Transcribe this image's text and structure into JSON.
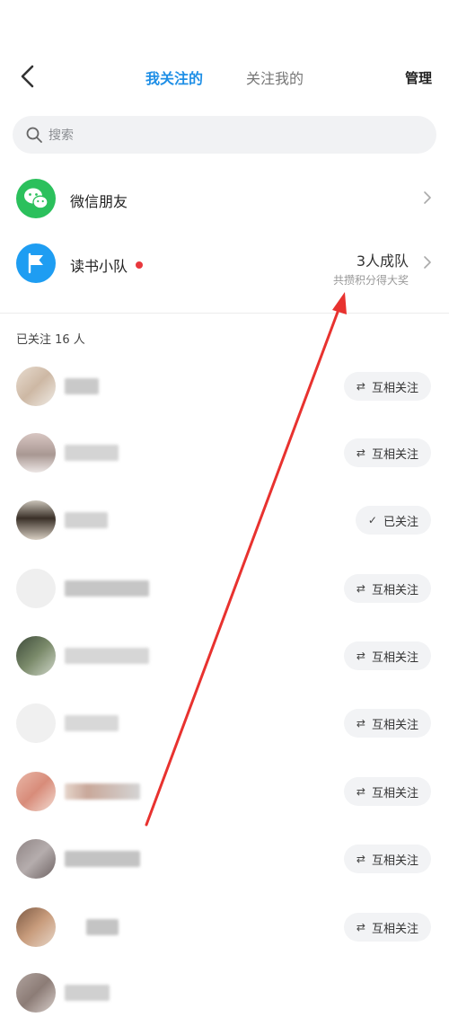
{
  "header": {
    "tabs": [
      {
        "label": "我关注的",
        "active": true
      },
      {
        "label": "关注我的",
        "active": false
      }
    ],
    "manage_label": "管理",
    "back_icon": "chevron-left-icon"
  },
  "search": {
    "placeholder": "搜索",
    "icon": "search-icon"
  },
  "wechat": {
    "label": "微信朋友",
    "icon": "wechat-icon"
  },
  "team": {
    "label": "读书小队",
    "count_label": "3人成队",
    "sub_label": "共攒积分得大奖",
    "icon": "flag-icon"
  },
  "following": {
    "count_label": "已关注 16 人",
    "users": [
      {
        "button": "互相关注",
        "button_icon": "⇄",
        "state": "mutual"
      },
      {
        "button": "互相关注",
        "button_icon": "⇄",
        "state": "mutual"
      },
      {
        "button": "已关注",
        "button_icon": "✓",
        "state": "followed"
      },
      {
        "button": "互相关注",
        "button_icon": "⇄",
        "state": "mutual"
      },
      {
        "button": "互相关注",
        "button_icon": "⇄",
        "state": "mutual"
      },
      {
        "button": "互相关注",
        "button_icon": "⇄",
        "state": "mutual"
      },
      {
        "button": "互相关注",
        "button_icon": "⇄",
        "state": "mutual"
      },
      {
        "button": "互相关注",
        "button_icon": "⇄",
        "state": "mutual"
      },
      {
        "button": "互相关注",
        "button_icon": "⇄",
        "state": "mutual"
      }
    ]
  },
  "colors": {
    "accent": "#1f8fe6",
    "wechat": "#2bc05c",
    "team": "#1e9df2",
    "annotation": "#e8322f",
    "red_dot": "#e8383d"
  }
}
